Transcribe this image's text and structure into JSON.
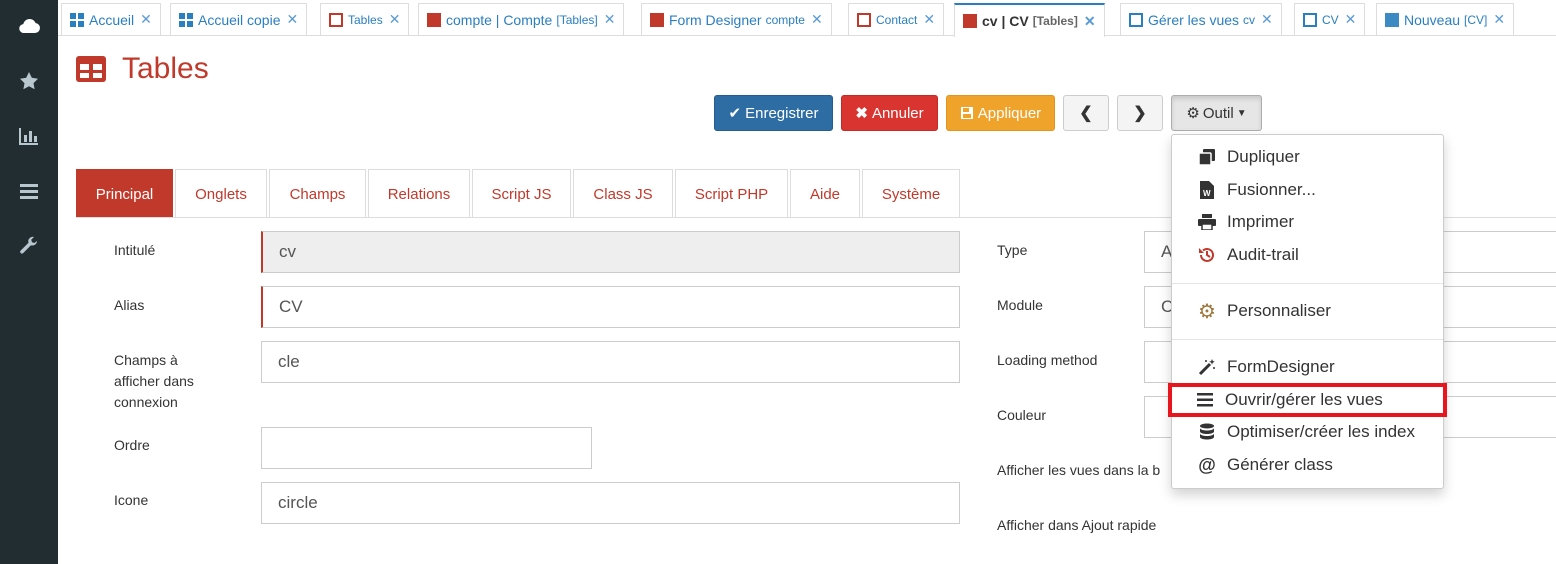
{
  "rail": {
    "icons": [
      "cloud-icon",
      "star-icon",
      "bar-chart-icon",
      "list-icon",
      "wrench-icon"
    ]
  },
  "tabs": [
    {
      "label": "Accueil",
      "sub": "",
      "icon": "grid"
    },
    {
      "label": "Accueil copie",
      "sub": "",
      "icon": "grid"
    },
    {
      "label": "Tables",
      "sub": "",
      "icon": "table-outline"
    },
    {
      "label": "compte | Compte",
      "sub": "[Tables]",
      "icon": "table-red"
    },
    {
      "label": "Form Designer",
      "sub": "compte",
      "icon": "table-red"
    },
    {
      "label": "Contact",
      "sub": "",
      "icon": "table-outline"
    },
    {
      "label": "cv | CV",
      "sub": "[Tables]",
      "icon": "table-red"
    },
    {
      "label": "Gérer les vues",
      "sub": "cv",
      "icon": "window-blue"
    },
    {
      "label": "CV",
      "sub": "",
      "icon": "window-blue"
    },
    {
      "label": "Nouveau",
      "sub": "[CV]",
      "icon": "window-blue-solid"
    }
  ],
  "page": {
    "title": "Tables"
  },
  "toolbar": {
    "save": "Enregistrer",
    "cancel": "Annuler",
    "apply": "Appliquer",
    "tool": "Outil"
  },
  "form_tabs": [
    "Principal",
    "Onglets",
    "Champs",
    "Relations",
    "Script JS",
    "Class JS",
    "Script PHP",
    "Aide",
    "Système"
  ],
  "form": {
    "intitule_label": "Intitulé",
    "intitule_value": "cv",
    "alias_label": "Alias",
    "alias_value": "CV",
    "champs_label_1": "Champs à",
    "champs_label_2": "afficher dans",
    "champs_label_3": "connexion",
    "champs_value": "cle",
    "ordre_label": "Ordre",
    "ordre_value": "",
    "icone_label": "Icone",
    "icone_value": "circle",
    "type_label": "Type",
    "type_value": "A",
    "module_label": "Module",
    "module_value": "C",
    "loading_label": "Loading method",
    "couleur_label": "Couleur",
    "afficher_vues_label": "Afficher les vues dans la b",
    "afficher_ajout_label": "Afficher dans Ajout rapide"
  },
  "menu": {
    "items": [
      "Dupliquer",
      "Fusionner...",
      "Imprimer",
      "Audit-trail",
      "Personnaliser",
      "FormDesigner",
      "Ouvrir/gérer les vues",
      "Optimiser/créer les index",
      "Générer class"
    ]
  },
  "colors": {
    "accent_red": "#c0392b",
    "link_blue": "#2a7fc1",
    "rail": "#222d32",
    "highlight": "#e8141e"
  }
}
